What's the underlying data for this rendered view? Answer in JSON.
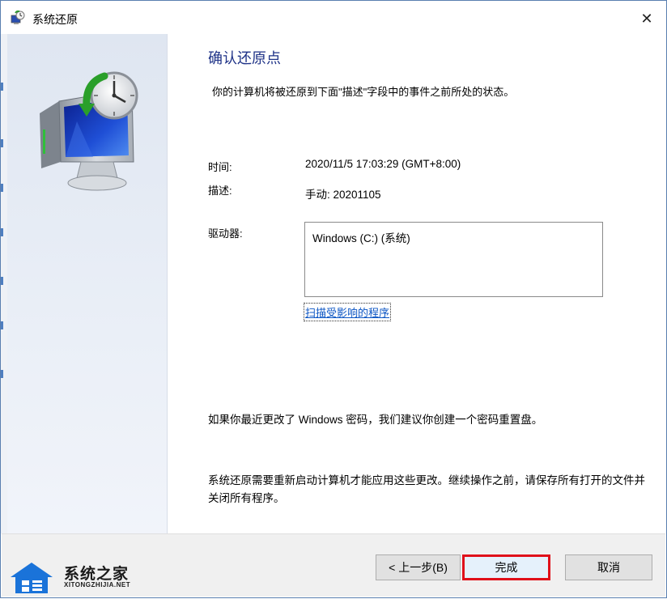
{
  "window": {
    "title": "系统还原",
    "close_glyph": "✕"
  },
  "icons": {
    "title": "system-restore-icon",
    "hero": "monitor-clock-restore-icon",
    "close": "close-icon"
  },
  "content": {
    "heading": "确认还原点",
    "subtitle": "你的计算机将被还原到下面\"描述\"字段中的事件之前所处的状态。",
    "time_label": "时间:",
    "time_value": "2020/11/5 17:03:29 (GMT+8:00)",
    "desc_label": "描述:",
    "desc_value": "手动: 20201105",
    "drive_label": "驱动器:",
    "drives": [
      "Windows (C:) (系统)"
    ],
    "scan_link": "扫描受影响的程序",
    "note_password": "如果你最近更改了 Windows 密码，我们建议你创建一个密码重置盘。",
    "note_restart": "系统还原需要重新启动计算机才能应用这些更改。继续操作之前，请保存所有打开的文件并关闭所有程序。"
  },
  "buttons": {
    "back": "< 上一步(B)",
    "finish": "完成",
    "cancel": "取消"
  },
  "watermark": {
    "title": "系统之家",
    "subtitle": "XITONGZHIJIA.NET"
  },
  "colors": {
    "heading": "#1e3287",
    "link": "#0b55c4",
    "highlight": "#e0101a"
  }
}
